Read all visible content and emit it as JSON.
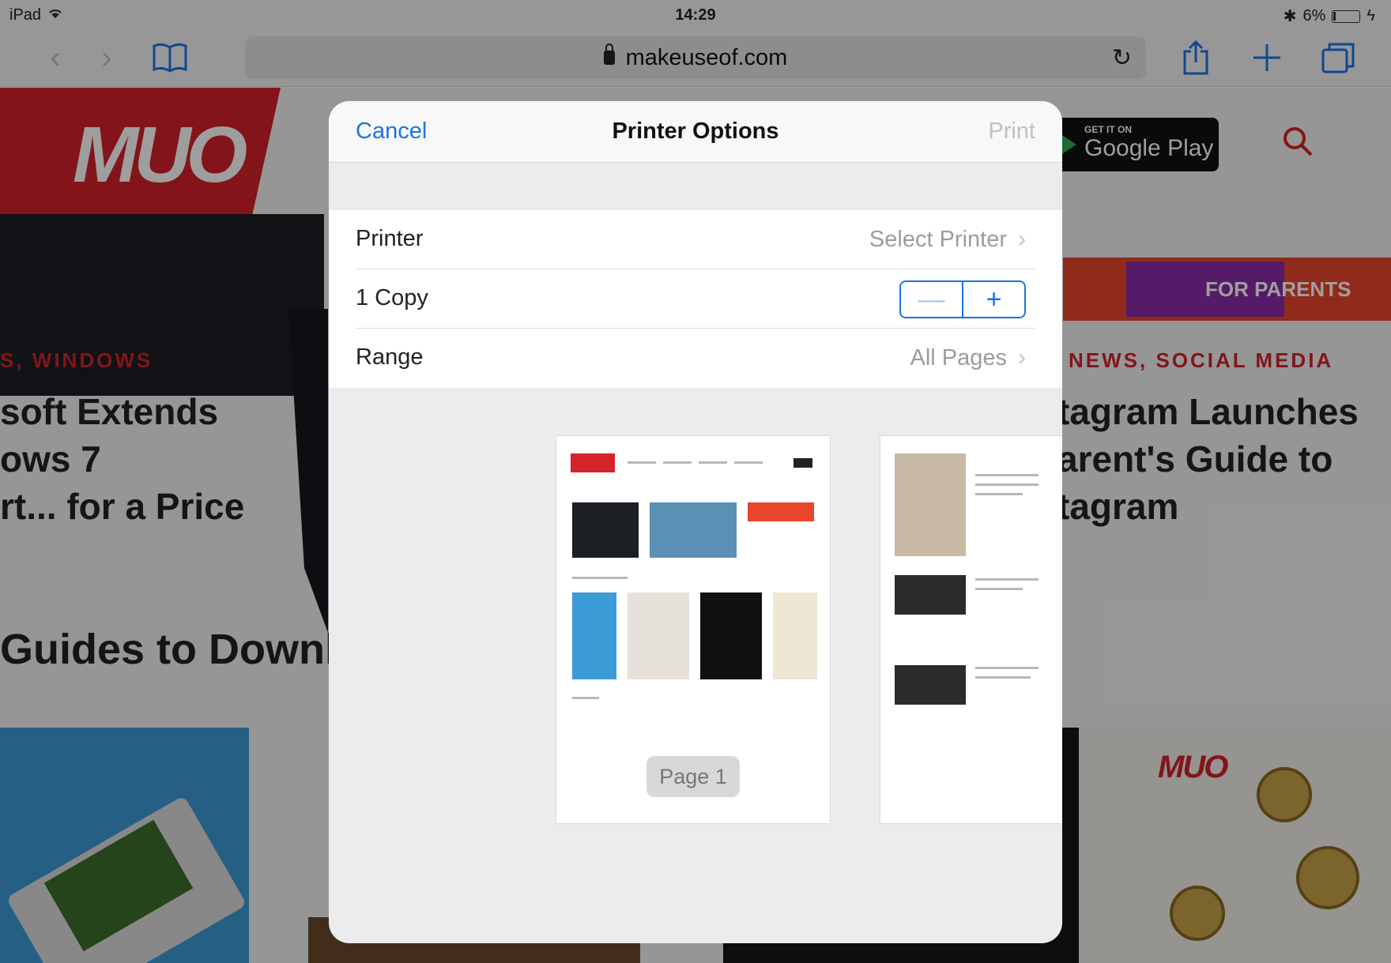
{
  "status_bar": {
    "device": "iPad",
    "time": "14:29",
    "battery": "6%"
  },
  "toolbar": {
    "url": "makeuseof.com",
    "icons": [
      "back-icon",
      "forward-icon",
      "bookmarks-icon",
      "reload-icon",
      "share-icon",
      "new-tab-icon",
      "tabs-icon"
    ]
  },
  "background_page": {
    "logo": "MUO",
    "store_badge_small": "GET IT ON",
    "store_badge_big": "Google Play",
    "left_category": "S,  WINDOWS",
    "left_title": "soft Extends\nows 7\nrt... for a Price",
    "section_heading": "Guides to Downl",
    "right_banner": "FOR PARENTS",
    "right_category": "NEWS,  SOCIAL MEDIA",
    "right_title": "tagram Launches\narent's Guide to\ntagram",
    "right_thumb_logo": "MUO"
  },
  "sheet": {
    "cancel_label": "Cancel",
    "title": "Printer Options",
    "print_label": "Print",
    "rows": [
      {
        "label": "Printer",
        "value": "Select Printer"
      },
      {
        "label": "1 Copy"
      },
      {
        "label": "Range",
        "value": "All Pages"
      }
    ],
    "stepper": {
      "minus": "—",
      "plus": "+"
    },
    "preview_page_label": "Page 1"
  },
  "colors": {
    "accent": "#1a73e8",
    "brand_red": "#d4232b"
  }
}
